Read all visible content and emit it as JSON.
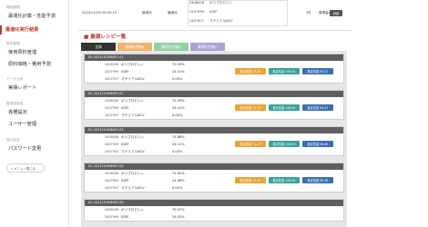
{
  "colors": {
    "accent": "#c0392b",
    "badge_orange": "#e8a33b",
    "badge_teal": "#3aa29b",
    "badge_blue": "#3b6fb4",
    "tab_dark": "#333333",
    "tab_orange": "#f0b46a",
    "tab_green": "#8fd1a3",
    "tab_purple": "#a9a3d6"
  },
  "sidebar": {
    "group1": "需給管理",
    "items1": [
      "最適化計算・性能予測",
      "最適化実行結果"
    ],
    "group2": "原料管理",
    "items2": [
      "使用原料管理",
      "原料価格・費用予測"
    ],
    "group3": "データ分析",
    "items3": [
      "実績レポート"
    ],
    "group4": "管理者設定",
    "items4": [
      "各種設定",
      "ユーザー管理"
    ],
    "group5": "個人設定",
    "items5": [
      "パスワード変更"
    ],
    "collapse_label": "« メニュー閉じる"
  },
  "top": {
    "datetime": "2024/11/26 09:45:19",
    "col1": "最適化",
    "col2": "最適化",
    "rows": [
      {
        "id": "2408006",
        "name": "ポリプロピレン"
      },
      {
        "id": "2407999",
        "name": "IGEP"
      },
      {
        "id": "2407907",
        "name": "マテリアルNCV"
      }
    ],
    "count": "3件",
    "user": "管理者A",
    "button": "詳細"
  },
  "section_title": "■ 最適レシピ一覧",
  "tabs": [
    "全体",
    "最適化性能A",
    "最適化性能B",
    "最適化性能C"
  ],
  "cards": [
    {
      "head": "ID: 241119-058657-01",
      "rows": [
        [
          "2408006",
          "ポリプロピレン",
          "75.59%"
        ],
        [
          "2407999",
          "IGEP",
          "24.41%"
        ],
        [
          "2407907",
          "マテリアルNCV",
          "0.00%"
        ]
      ],
      "badges": [
        "推定性能 71.80",
        "推定性能 106.00",
        "推定性能 98.11"
      ]
    },
    {
      "head": "ID: 241119-058657-02",
      "rows": [
        [
          "2408006",
          "ポリプロピレン",
          "75.59%"
        ],
        [
          "2407999",
          "IGEP",
          "24.41%"
        ],
        [
          "2407907",
          "マテリアルNCV",
          "0.00%"
        ]
      ],
      "badges": [
        "推定性能 71.79",
        "推定性能 106.00",
        "推定性能 98.47"
      ]
    },
    {
      "head": "ID: 241119-058657-03",
      "rows": [
        [
          "2408006",
          "ポリプロピレン",
          "75.88%"
        ],
        [
          "2407999",
          "IGEP",
          "24.12%"
        ],
        [
          "2407907",
          "マテリアルNCV",
          "0.00%"
        ]
      ],
      "badges": [
        "推定性能 71.47",
        "推定性能 106.00",
        "推定性能 98.40"
      ]
    },
    {
      "head": "ID: 241119-058657-04",
      "rows": [
        [
          "2408006",
          "ポリプロピレン",
          "75.92%"
        ],
        [
          "2407999",
          "IGEP",
          "24.08%"
        ],
        [
          "2407907",
          "マテリアルNCV",
          "0.00%"
        ]
      ],
      "badges": [
        "推定性能 71.44",
        "推定性能 106.00",
        "推定性能 98.38"
      ]
    },
    {
      "head": "ID: 241119-058657-05",
      "rows": [
        [
          "2408006",
          "ポリプロピレン",
          "75.97%"
        ],
        [
          "2407999",
          "IGEP",
          "24.03%"
        ]
      ],
      "badges": []
    }
  ]
}
